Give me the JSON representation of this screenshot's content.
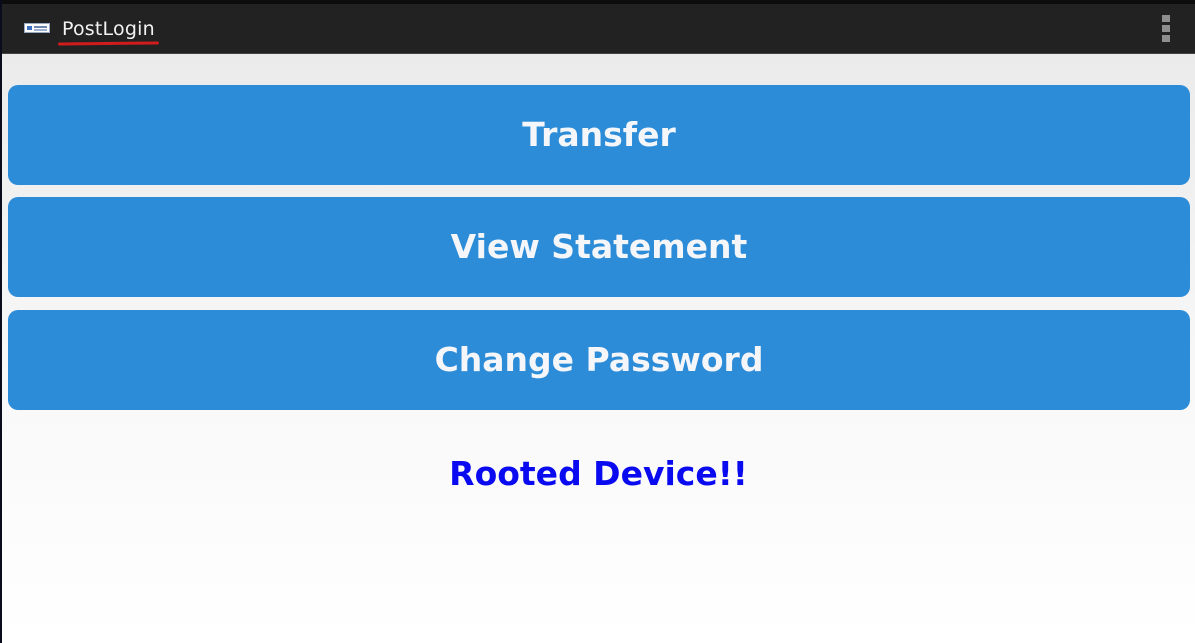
{
  "app_bar": {
    "icon": "app-logo-icon",
    "title": "PostLogin",
    "overflow_icon": "overflow-menu-icon"
  },
  "buttons": {
    "transfer": "Transfer",
    "view_statement": "View Statement",
    "change_password": "Change Password"
  },
  "status_message": "Rooted Device!!",
  "colors": {
    "app_bar": "#222222",
    "button": "#2d8cd8",
    "button_text": "#f4f6fa",
    "warning_text": "#0a0af0",
    "title_underline": "#d01c1c"
  }
}
